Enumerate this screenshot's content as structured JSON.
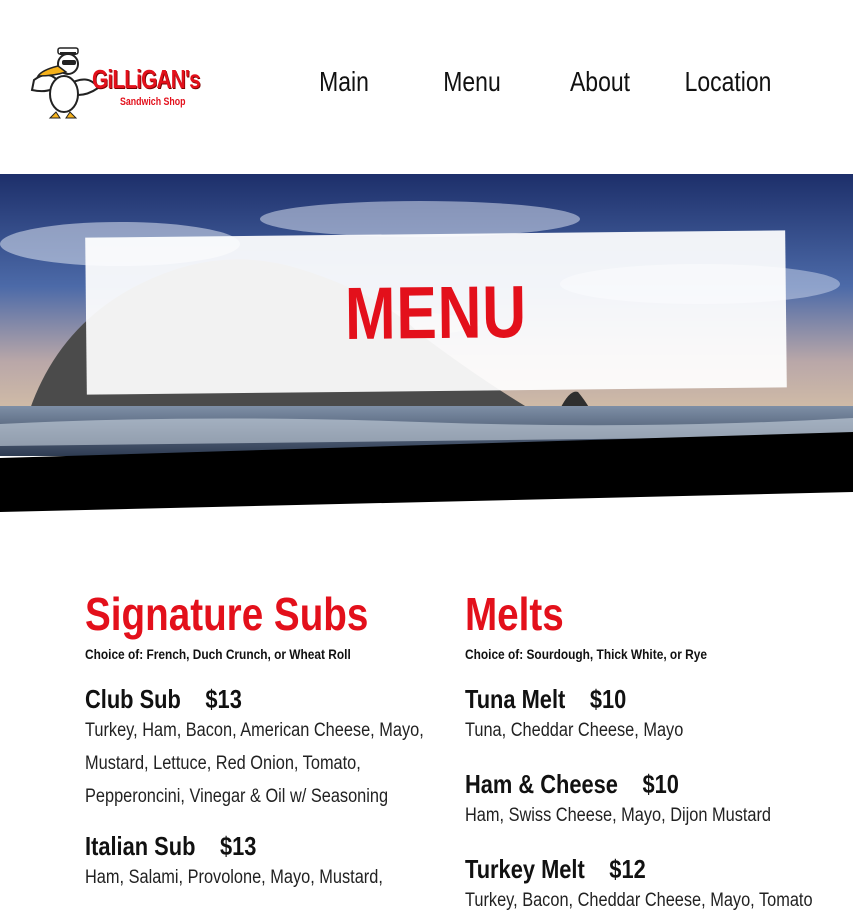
{
  "brand": {
    "name": "GiLLiGAN's",
    "tagline": "Sandwich Shop",
    "colors": {
      "accent": "#e3101b",
      "text": "#111111",
      "background": "#ffffff"
    }
  },
  "nav": {
    "items": [
      {
        "label": "Main"
      },
      {
        "label": "Menu"
      },
      {
        "label": "About"
      },
      {
        "label": "Location"
      }
    ]
  },
  "hero": {
    "title": "MENU"
  },
  "sections": [
    {
      "title": "Signature Subs",
      "note": "Choice of: French, Duch Crunch, or Wheat Roll",
      "items": [
        {
          "name": "Club Sub",
          "price": "$13",
          "description": "Turkey, Ham, Bacon, American Cheese, Mayo, Mustard, Lettuce, Red Onion, Tomato, Pepperoncini, Vinegar & Oil w/ Seasoning"
        },
        {
          "name": "Italian Sub",
          "price": "$13",
          "description": "Ham, Salami, Provolone, Mayo, Mustard,"
        }
      ]
    },
    {
      "title": "Melts",
      "note": "Choice of: Sourdough, Thick White, or Rye",
      "items": [
        {
          "name": "Tuna Melt",
          "price": "$10",
          "description": "Tuna, Cheddar Cheese, Mayo"
        },
        {
          "name": "Ham & Cheese",
          "price": "$10",
          "description": "Ham, Swiss Cheese, Mayo, Dijon Mustard"
        },
        {
          "name": "Turkey Melt",
          "price": "$12",
          "description": "Turkey, Bacon, Cheddar Cheese, Mayo, Tomato"
        }
      ]
    }
  ]
}
